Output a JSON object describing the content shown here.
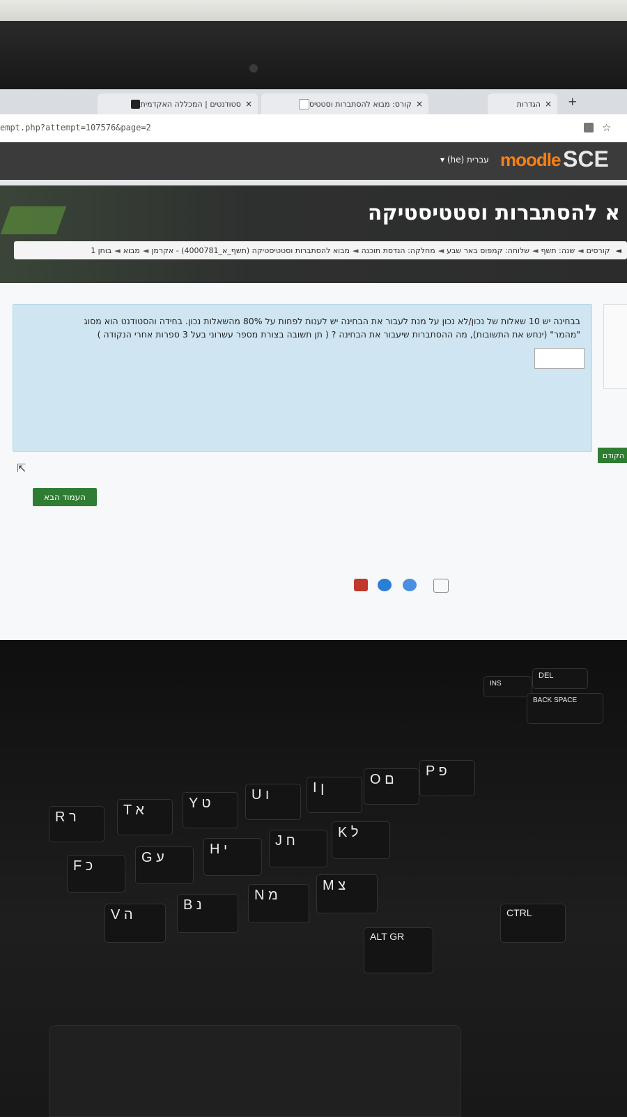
{
  "browser": {
    "tabs": [
      {
        "label": "סטודנטים | המכללה האקדמית",
        "close": "×"
      },
      {
        "label": "קורס: מבוא להסתברות וסטטיס",
        "close": "×"
      },
      {
        "label": "הגדרות",
        "close": "×"
      }
    ],
    "new_tab": "+",
    "url": "empt.php?attempt=107576&page=2"
  },
  "moodle": {
    "logo_moodle": "moodle",
    "logo_sce": "SCE",
    "language": "עברית (he) ▾"
  },
  "course": {
    "title": "א להסתברות וסטטיסטיקה",
    "breadcrumb": [
      "קורסים",
      "שנה: תשף",
      "שלוחה: קמפוס באר שבע",
      "מחלקה: הנדסת תוכנה",
      "מבוא להסתברות וסטטיסטיקה (תשף_א_4000781) - אקרמן",
      "מבוא",
      "בוחן 1"
    ],
    "breadcrumb_sep": "◄"
  },
  "question": {
    "line1": "בבחינה יש 10 שאלות של נכון/לא נכון על מנת לעבור את הבחינה יש לענות לפחות על 80% מהשאלות נכון. בחידה והסטודנט הוא מסוג",
    "line2": "\"מהמר\" (ינחש את התשובות), מה ההסתברות שיעבור את הבחינה ? ( תן תשובה בצורת מספר עשרוני בעל 3 ספרות אחרי הנקודה )",
    "answer_value": ""
  },
  "nav": {
    "next_label": "העמוד הבא",
    "prev_label": "הקודם"
  },
  "keyboard": {
    "keys": [
      "R ר",
      "T א",
      "Y ט",
      "U ו",
      "I ן",
      "O ם",
      "P פ",
      "F כ",
      "G ע",
      "H י",
      "J ח",
      "K ל",
      "V ה",
      "B נ",
      "N מ",
      "M צ",
      "ALT GR",
      "CTRL",
      "DEL",
      "INS",
      "BACK SPACE"
    ]
  }
}
